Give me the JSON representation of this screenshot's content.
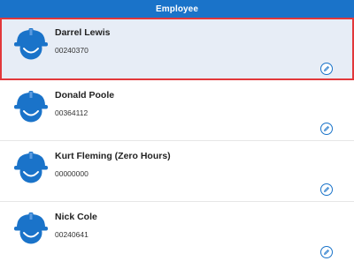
{
  "header": {
    "title": "Employee"
  },
  "colors": {
    "header_bg": "#1a73c9",
    "icon_blue": "#1a73c9",
    "selected_bg": "#e7edf6",
    "selected_border": "#e2383b"
  },
  "icons": {
    "avatar": "hard-hat-worker-icon",
    "edit": "pencil-edit-icon"
  },
  "employees": [
    {
      "name": "Darrel Lewis",
      "id": "00240370",
      "selected": true
    },
    {
      "name": "Donald Poole",
      "id": "00364112",
      "selected": false
    },
    {
      "name": "Kurt Fleming (Zero Hours)",
      "id": "00000000",
      "selected": false
    },
    {
      "name": "Nick Cole",
      "id": "00240641",
      "selected": false
    }
  ]
}
